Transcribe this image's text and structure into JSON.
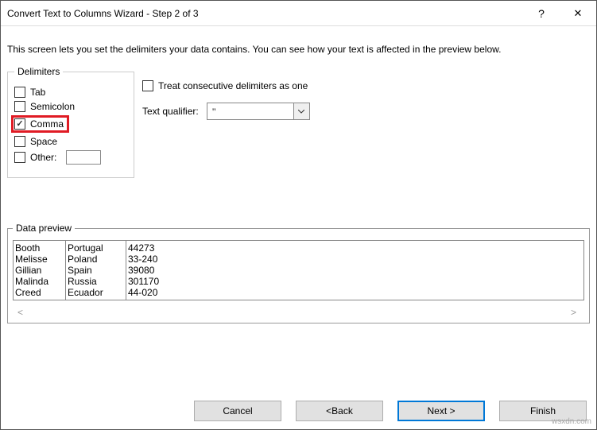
{
  "titlebar": {
    "title": "Convert Text to Columns Wizard - Step 2 of 3",
    "help": "?",
    "close": "✕"
  },
  "description": "This screen lets you set the delimiters your data contains.  You can see how your text is affected in the preview below.",
  "delimiters": {
    "legend": "Delimiters",
    "tab": "Tab",
    "semicolon": "Semicolon",
    "comma": "Comma",
    "space": "Space",
    "other": "Other:"
  },
  "options": {
    "consecutive": "Treat consecutive delimiters as one",
    "qualifier_label": "Text qualifier:",
    "qualifier_value": "\""
  },
  "preview": {
    "legend": "Data preview",
    "rows": [
      {
        "c1": "Booth",
        "c2": "Portugal",
        "c3": "44273"
      },
      {
        "c1": "Melisse",
        "c2": "Poland",
        "c3": "33-240"
      },
      {
        "c1": "Gillian",
        "c2": "Spain",
        "c3": "39080"
      },
      {
        "c1": "Malinda",
        "c2": "Russia",
        "c3": "301170"
      },
      {
        "c1": "Creed",
        "c2": "Ecuador",
        "c3": "44-020"
      }
    ]
  },
  "buttons": {
    "cancel": "Cancel",
    "back": "< Back",
    "next": "Next >",
    "finish": "Finish"
  },
  "watermark": "wsxdn.com"
}
